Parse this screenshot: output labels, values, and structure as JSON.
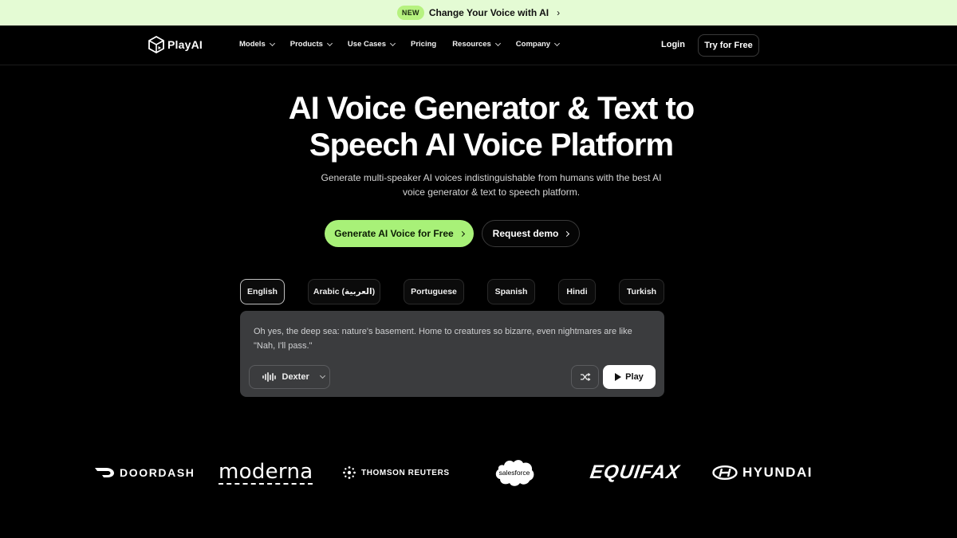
{
  "announcement": {
    "badge": "NEW",
    "text": "Change Your Voice with AI"
  },
  "nav": {
    "logo_text": "PlayAI",
    "items": [
      {
        "label": "Models",
        "dropdown": true
      },
      {
        "label": "Products",
        "dropdown": true
      },
      {
        "label": "Use Cases",
        "dropdown": true
      },
      {
        "label": "Pricing",
        "dropdown": false
      },
      {
        "label": "Resources",
        "dropdown": true
      },
      {
        "label": "Company",
        "dropdown": true
      }
    ],
    "login": "Login",
    "try_free": "Try for Free"
  },
  "hero": {
    "title_line1": "AI Voice Generator & Text to",
    "title_line2": "Speech AI Voice Platform",
    "subtitle_line1": "Generate multi-speaker AI voices indistinguishable from humans with the best AI",
    "subtitle_line2": "voice generator & text to speech platform.",
    "cta_primary": "Generate AI Voice for Free",
    "cta_secondary": "Request demo"
  },
  "languages": {
    "active": "English",
    "items": [
      "English",
      "Arabic (العربية)",
      "Portuguese",
      "Spanish",
      "Hindi",
      "Turkish"
    ]
  },
  "demo": {
    "sample_text": "Oh yes, the deep sea: nature's basement. Home to creatures so bizarre, even nightmares are like \"Nah, I'll pass.\"",
    "voice_name": "Dexter",
    "play_label": "Play"
  },
  "logos": {
    "doordash": "DOORDASH",
    "moderna": "moderna",
    "thomson_reuters": "THOMSON REUTERS",
    "salesforce": "salesforce",
    "equifax": "EQUIFAX",
    "hyundai": "HYUNDAI"
  },
  "colors": {
    "background": "#000000",
    "accent_green": "#a8f178",
    "announcement_bg": "#e4fbd4",
    "card_bg": "#3b3c3e",
    "salesforce_blue": "#00a1e0"
  }
}
